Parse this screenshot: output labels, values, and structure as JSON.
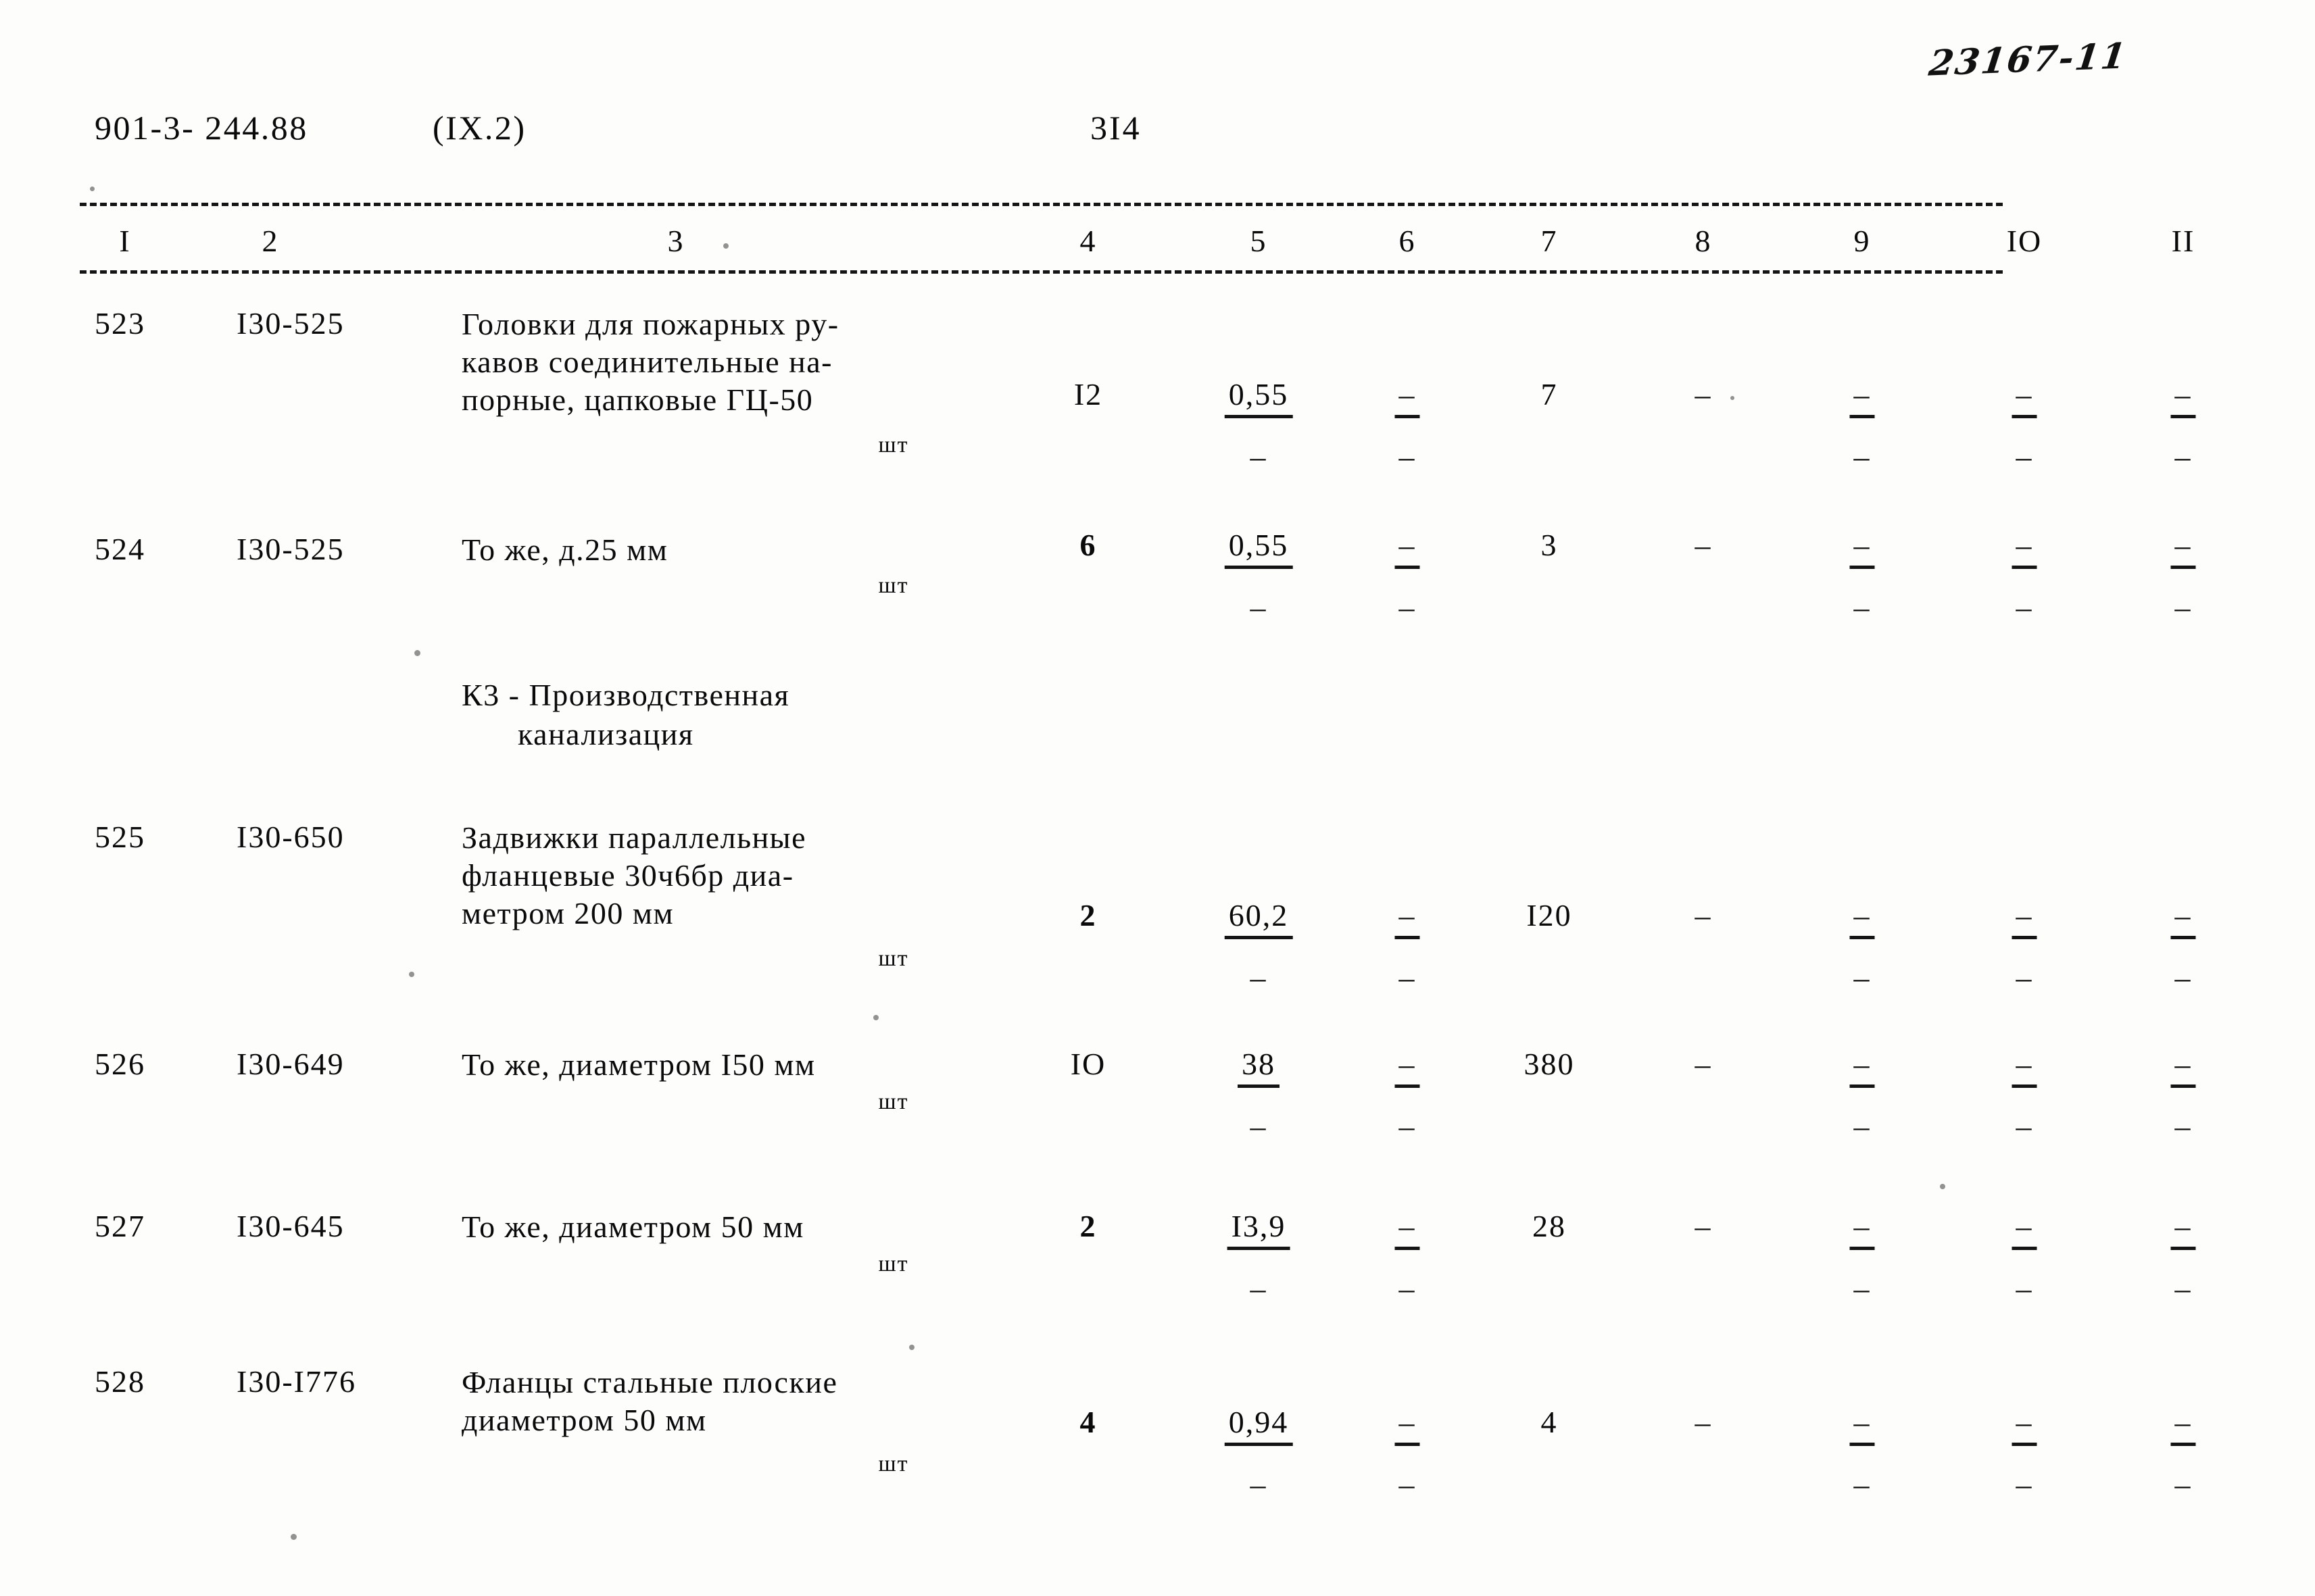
{
  "header": {
    "hand_note": "23167-11",
    "doc_code": "901-3- 244.88",
    "doc_section": "(IX.2)",
    "page_number": "3I4"
  },
  "table": {
    "column_headers": [
      "I",
      "2",
      "3",
      "4",
      "5",
      "6",
      "7",
      "8",
      "9",
      "IO",
      "II"
    ],
    "unit_label": "шт",
    "dash": "–",
    "rows": [
      {
        "pos": "523",
        "code": "I30-525",
        "name_lines": [
          "Головки для пожарных ру-",
          "кавов соединительные на-",
          "порные, цапковые ГЦ-50"
        ],
        "unit": "шт",
        "c4": "I2",
        "c5_top": "0,55",
        "c5_bot": "–",
        "c6_top": "–",
        "c6_bot": "–",
        "c7": "7",
        "c8": "–",
        "c9_top": "–",
        "c9_bot": "–",
        "c10_top": "–",
        "c10_bot": "–",
        "c11_top": "–",
        "c11_bot": "–"
      },
      {
        "pos": "524",
        "code": "I30-525",
        "name_lines": [
          "То же, д.25 мм"
        ],
        "unit": "шт",
        "c4": "6",
        "c5_top": "0,55",
        "c5_bot": "–",
        "c6_top": "–",
        "c6_bot": "–",
        "c7": "3",
        "c8": "–",
        "c9_top": "–",
        "c9_bot": "–",
        "c10_top": "–",
        "c10_bot": "–",
        "c11_top": "–",
        "c11_bot": "–"
      },
      {
        "pos": "525",
        "code": "I30-650",
        "name_lines": [
          "Задвижки параллельные",
          "фланцевые 30ч6бр диа-",
          "метром 200 мм"
        ],
        "unit": "шт",
        "c4": "2",
        "c5_top": "60,2",
        "c5_bot": "–",
        "c6_top": "–",
        "c6_bot": "–",
        "c7": "I20",
        "c8": "–",
        "c9_top": "–",
        "c9_bot": "–",
        "c10_top": "–",
        "c10_bot": "–",
        "c11_top": "–",
        "c11_bot": "–"
      },
      {
        "pos": "526",
        "code": "I30-649",
        "name_lines": [
          "То же, диаметром I50 мм"
        ],
        "unit": "шт",
        "c4": "IO",
        "c5_top": "38",
        "c5_bot": "–",
        "c6_top": "–",
        "c6_bot": "–",
        "c7": "380",
        "c8": "–",
        "c9_top": "–",
        "c9_bot": "–",
        "c10_top": "–",
        "c10_bot": "–",
        "c11_top": "–",
        "c11_bot": "–"
      },
      {
        "pos": "527",
        "code": "I30-645",
        "name_lines": [
          "То же, диаметром 50 мм"
        ],
        "unit": "шт",
        "c4": "2",
        "c5_top": "I3,9",
        "c5_bot": "–",
        "c6_top": "–",
        "c6_bot": "–",
        "c7": "28",
        "c8": "–",
        "c9_top": "–",
        "c9_bot": "–",
        "c10_top": "–",
        "c10_bot": "–",
        "c11_top": "–",
        "c11_bot": "–"
      },
      {
        "pos": "528",
        "code": "I30-I776",
        "name_lines": [
          "Фланцы стальные плоские",
          "диаметром 50 мм"
        ],
        "unit": "шт",
        "c4": "4",
        "c5_top": "0,94",
        "c5_bot": "–",
        "c6_top": "–",
        "c6_bot": "–",
        "c7": "4",
        "c8": "–",
        "c9_top": "–",
        "c9_bot": "–",
        "c10_top": "–",
        "c10_bot": "–",
        "c11_top": "–",
        "c11_bot": "–"
      }
    ],
    "section_heading": {
      "line1": "К3 - Производственная",
      "line2": "канализация"
    }
  }
}
